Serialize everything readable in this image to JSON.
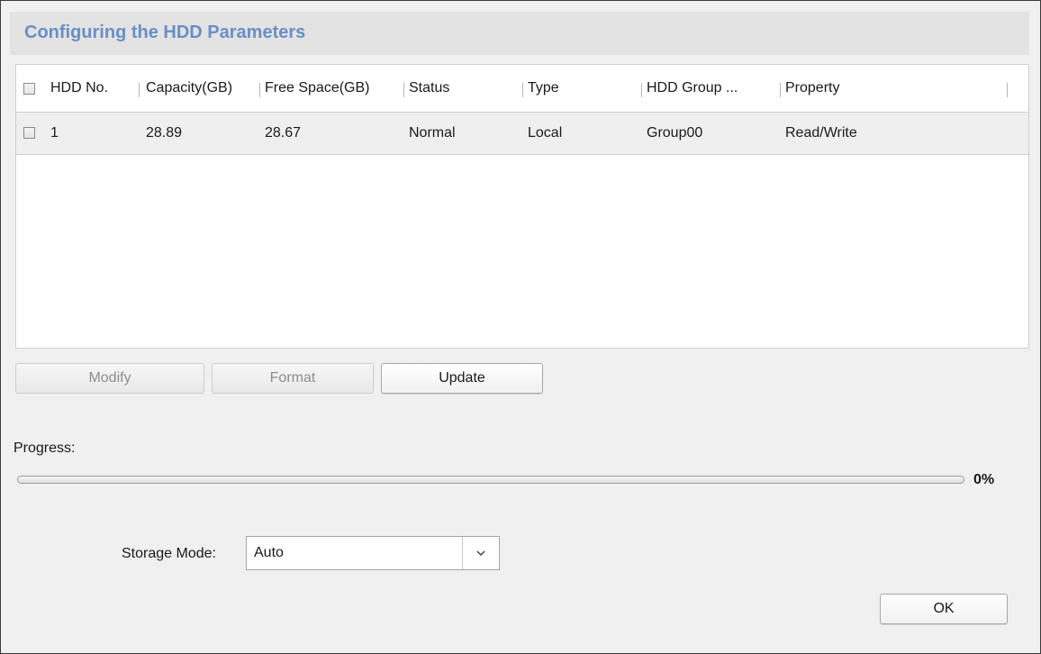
{
  "dialog": {
    "title": "Configuring the HDD Parameters"
  },
  "table": {
    "columns": [
      "HDD No.",
      "Capacity(GB)",
      "Free Space(GB)",
      "Status",
      "Type",
      "HDD Group ...",
      "Property"
    ],
    "rows": [
      {
        "checked": false,
        "hdd_no": "1",
        "capacity": "28.89",
        "free_space": "28.67",
        "status": "Normal",
        "type": "Local",
        "group": "Group00",
        "property": "Read/Write"
      }
    ]
  },
  "actions": {
    "modify_label": "Modify",
    "format_label": "Format",
    "update_label": "Update"
  },
  "progress": {
    "label": "Progress:",
    "value_percent": 0,
    "value_text": "0%"
  },
  "storage": {
    "label": "Storage Mode:",
    "selected": "Auto"
  },
  "footer": {
    "ok_label": "OK"
  },
  "colors": {
    "title": "#6a8fc7",
    "window_bg": "#f0f0f0",
    "row_bg": "#efefef"
  }
}
